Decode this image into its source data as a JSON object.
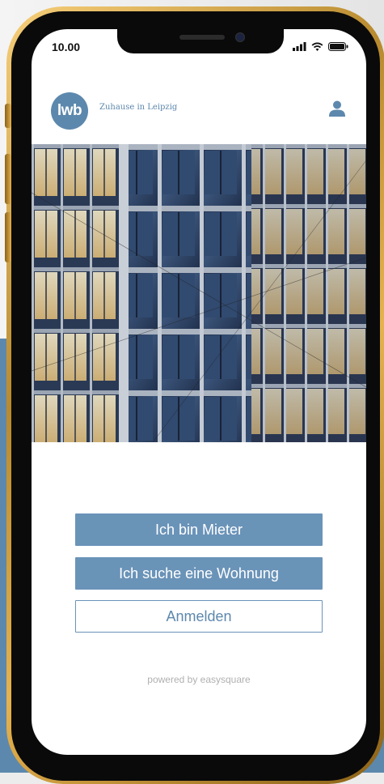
{
  "status": {
    "time": "10.00"
  },
  "header": {
    "logo_text": "lwb",
    "tagline": "Zuhause in Leipzig"
  },
  "actions": {
    "tenant_label": "Ich bin Mieter",
    "search_label": "Ich suche eine Wohnung",
    "login_label": "Anmelden"
  },
  "footer": {
    "powered_by": "powered by easysquare"
  },
  "colors": {
    "brand": "#5d88ad",
    "button": "#6a93b8",
    "frame_gold": "#d9a84a"
  },
  "icons": [
    "signal-icon",
    "wifi-icon",
    "battery-icon",
    "user-icon"
  ]
}
